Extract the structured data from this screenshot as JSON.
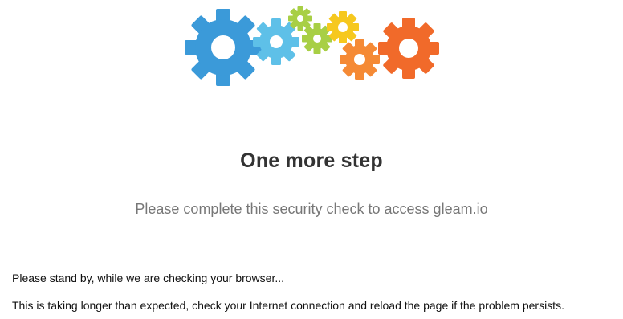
{
  "header": {
    "logo_icon": "colorful-gears-icon",
    "gear_colors": [
      "#3b9ad9",
      "#5ec0e8",
      "#a8cf45",
      "#a8cf45",
      "#f6c81e",
      "#f58a35",
      "#f16a2a"
    ]
  },
  "main": {
    "title": "One more step",
    "subtitle": "Please complete this security check to access gleam.io"
  },
  "status": {
    "line1": "Please stand by, while we are checking your browser...",
    "line2": "This is taking longer than expected, check your Internet connection and reload the page if the problem persists."
  }
}
